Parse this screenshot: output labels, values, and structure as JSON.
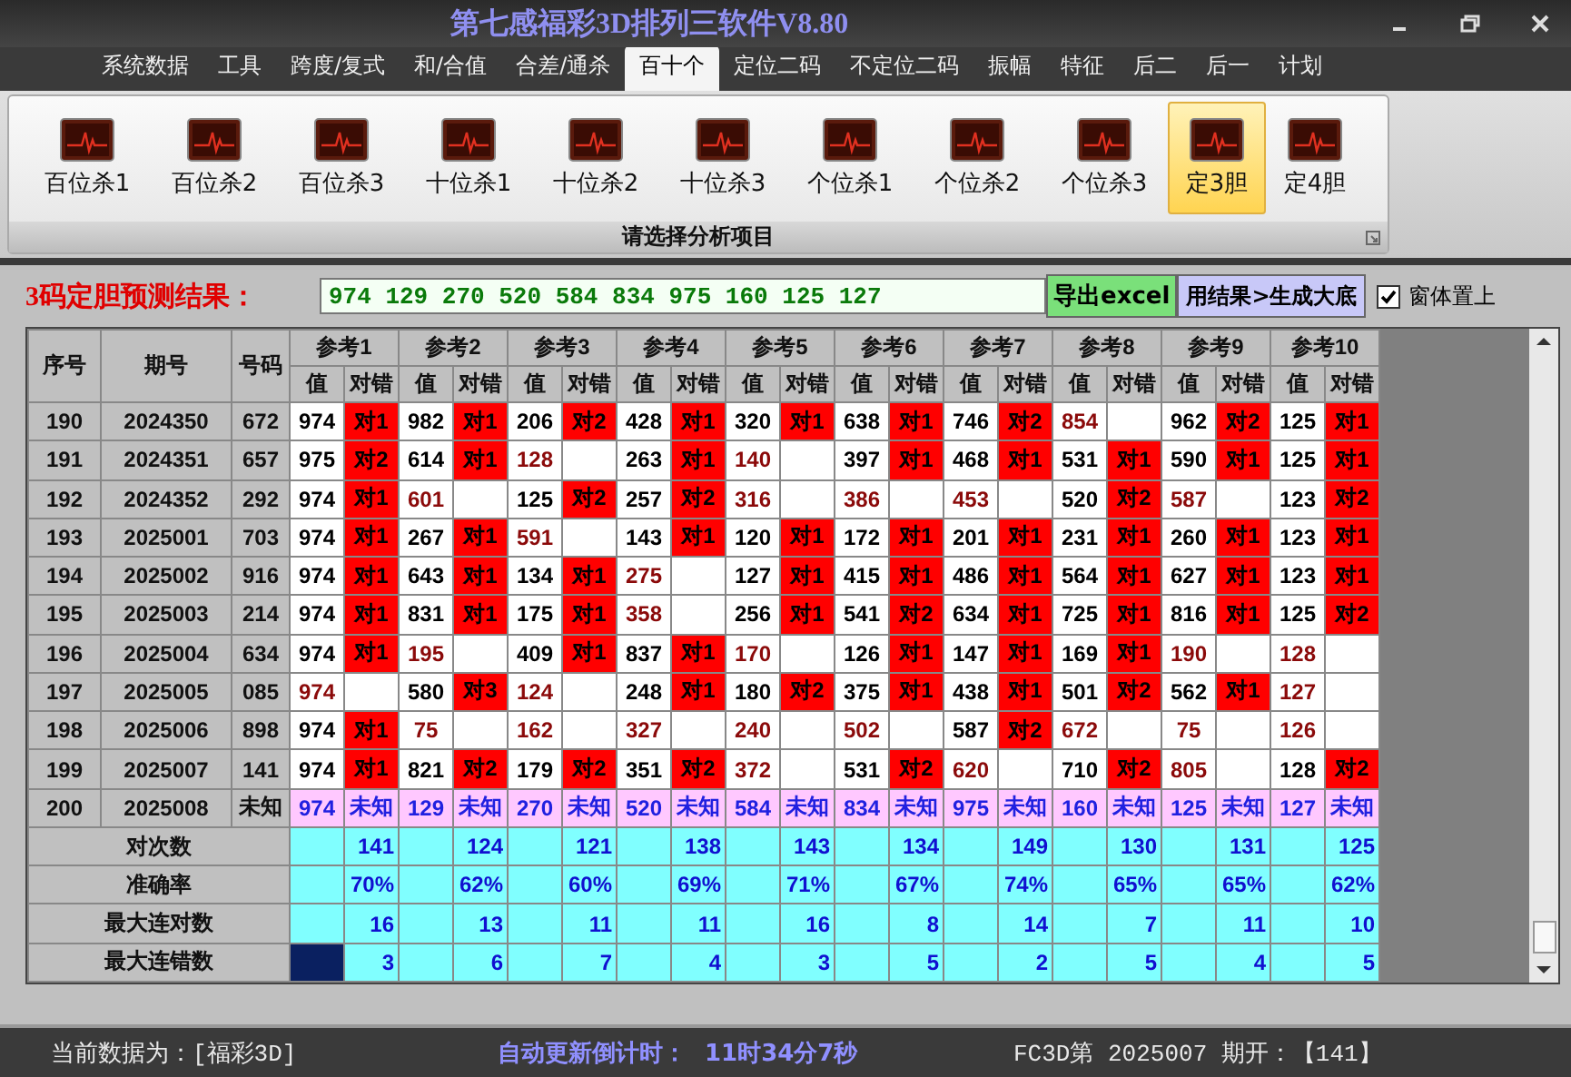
{
  "window": {
    "title": "第七感福彩3D排列三软件V8.80"
  },
  "menu_tabs": [
    {
      "label": "系统数据",
      "selected": false
    },
    {
      "label": "工具",
      "selected": false
    },
    {
      "label": "跨度/复式",
      "selected": false
    },
    {
      "label": "和/合值",
      "selected": false
    },
    {
      "label": "合差/通杀",
      "selected": false
    },
    {
      "label": "百十个",
      "selected": true
    },
    {
      "label": "定位二码",
      "selected": false
    },
    {
      "label": "不定位二码",
      "selected": false
    },
    {
      "label": "振幅",
      "selected": false
    },
    {
      "label": "特征",
      "selected": false
    },
    {
      "label": "后二",
      "selected": false
    },
    {
      "label": "后一",
      "selected": false
    },
    {
      "label": "计划",
      "selected": false
    }
  ],
  "ribbon": {
    "items": [
      {
        "label": "百位杀1",
        "selected": false
      },
      {
        "label": "百位杀2",
        "selected": false
      },
      {
        "label": "百位杀3",
        "selected": false
      },
      {
        "label": "十位杀1",
        "selected": false
      },
      {
        "label": "十位杀2",
        "selected": false
      },
      {
        "label": "十位杀3",
        "selected": false
      },
      {
        "label": "个位杀1",
        "selected": false
      },
      {
        "label": "个位杀2",
        "selected": false
      },
      {
        "label": "个位杀3",
        "selected": false
      },
      {
        "label": "定3胆",
        "selected": true
      },
      {
        "label": "定4胆",
        "selected": false
      }
    ],
    "group_label": "请选择分析项目"
  },
  "result_bar": {
    "label": "3码定胆预测结果：",
    "value": "974 129 270 520 584 834 975 160 125 127",
    "export_button": "导出excel",
    "generate_button": "用结果>生成大底",
    "topmost_checkbox": {
      "label": "窗体置上",
      "checked": true
    }
  },
  "table": {
    "columns": [
      "序号",
      "期号",
      "号码"
    ],
    "ref_headers": [
      {
        "label": "参考1",
        "value_header": "值",
        "result_header": "对错"
      },
      {
        "label": "参考2",
        "value_header": "值",
        "result_header": "对错"
      },
      {
        "label": "参考3",
        "value_header": "值",
        "result_header": "对错"
      },
      {
        "label": "参考4",
        "value_header": "值",
        "result_header": "对错"
      },
      {
        "label": "参考5",
        "value_header": "值",
        "result_header": "对错"
      },
      {
        "label": "参考6",
        "value_header": "值",
        "result_header": "对错"
      },
      {
        "label": "参考7",
        "value_header": "值",
        "result_header": "对错"
      },
      {
        "label": "参考8",
        "value_header": "值",
        "result_header": "对错"
      },
      {
        "label": "参考9",
        "value_header": "值",
        "result_header": "对错"
      },
      {
        "label": "参考10",
        "value_header": "值",
        "result_header": "对错"
      }
    ],
    "rows": [
      {
        "kind": "history",
        "no": "190",
        "issue": "2024350",
        "number": "672",
        "refs": [
          {
            "value": "974",
            "hit": true,
            "result": "对1"
          },
          {
            "value": "982",
            "hit": true,
            "result": "对1"
          },
          {
            "value": "206",
            "hit": true,
            "result": "对2"
          },
          {
            "value": "428",
            "hit": true,
            "result": "对1"
          },
          {
            "value": "320",
            "hit": true,
            "result": "对1"
          },
          {
            "value": "638",
            "hit": true,
            "result": "对1"
          },
          {
            "value": "746",
            "hit": true,
            "result": "对2"
          },
          {
            "value": "854",
            "hit": false
          },
          {
            "value": "962",
            "hit": true,
            "result": "对2"
          },
          {
            "value": "125",
            "hit": true,
            "result": "对1"
          }
        ]
      },
      {
        "kind": "history",
        "no": "191",
        "issue": "2024351",
        "number": "657",
        "refs": [
          {
            "value": "975",
            "hit": true,
            "result": "对2"
          },
          {
            "value": "614",
            "hit": true,
            "result": "对1"
          },
          {
            "value": "128",
            "hit": false
          },
          {
            "value": "263",
            "hit": true,
            "result": "对1"
          },
          {
            "value": "140",
            "hit": false
          },
          {
            "value": "397",
            "hit": true,
            "result": "对1"
          },
          {
            "value": "468",
            "hit": true,
            "result": "对1"
          },
          {
            "value": "531",
            "hit": true,
            "result": "对1"
          },
          {
            "value": "590",
            "hit": true,
            "result": "对1"
          },
          {
            "value": "125",
            "hit": true,
            "result": "对1"
          }
        ]
      },
      {
        "kind": "history",
        "no": "192",
        "issue": "2024352",
        "number": "292",
        "refs": [
          {
            "value": "974",
            "hit": true,
            "result": "对1"
          },
          {
            "value": "601",
            "hit": false
          },
          {
            "value": "125",
            "hit": true,
            "result": "对2"
          },
          {
            "value": "257",
            "hit": true,
            "result": "对2"
          },
          {
            "value": "316",
            "hit": false
          },
          {
            "value": "386",
            "hit": false
          },
          {
            "value": "453",
            "hit": false
          },
          {
            "value": "520",
            "hit": true,
            "result": "对2"
          },
          {
            "value": "587",
            "hit": false
          },
          {
            "value": "123",
            "hit": true,
            "result": "对2"
          }
        ]
      },
      {
        "kind": "history",
        "no": "193",
        "issue": "2025001",
        "number": "703",
        "refs": [
          {
            "value": "974",
            "hit": true,
            "result": "对1"
          },
          {
            "value": "267",
            "hit": true,
            "result": "对1"
          },
          {
            "value": "591",
            "hit": false
          },
          {
            "value": "143",
            "hit": true,
            "result": "对1"
          },
          {
            "value": "120",
            "hit": true,
            "result": "对1"
          },
          {
            "value": "172",
            "hit": true,
            "result": "对1"
          },
          {
            "value": "201",
            "hit": true,
            "result": "对1"
          },
          {
            "value": "231",
            "hit": true,
            "result": "对1"
          },
          {
            "value": "260",
            "hit": true,
            "result": "对1"
          },
          {
            "value": "123",
            "hit": true,
            "result": "对1"
          }
        ]
      },
      {
        "kind": "history",
        "no": "194",
        "issue": "2025002",
        "number": "916",
        "refs": [
          {
            "value": "974",
            "hit": true,
            "result": "对1"
          },
          {
            "value": "643",
            "hit": true,
            "result": "对1"
          },
          {
            "value": "134",
            "hit": true,
            "result": "对1"
          },
          {
            "value": "275",
            "hit": false
          },
          {
            "value": "127",
            "hit": true,
            "result": "对1"
          },
          {
            "value": "415",
            "hit": true,
            "result": "对1"
          },
          {
            "value": "486",
            "hit": true,
            "result": "对1"
          },
          {
            "value": "564",
            "hit": true,
            "result": "对1"
          },
          {
            "value": "627",
            "hit": true,
            "result": "对1"
          },
          {
            "value": "123",
            "hit": true,
            "result": "对1"
          }
        ]
      },
      {
        "kind": "history",
        "no": "195",
        "issue": "2025003",
        "number": "214",
        "refs": [
          {
            "value": "974",
            "hit": true,
            "result": "对1"
          },
          {
            "value": "831",
            "hit": true,
            "result": "对1"
          },
          {
            "value": "175",
            "hit": true,
            "result": "对1"
          },
          {
            "value": "358",
            "hit": false
          },
          {
            "value": "256",
            "hit": true,
            "result": "对1"
          },
          {
            "value": "541",
            "hit": true,
            "result": "对2"
          },
          {
            "value": "634",
            "hit": true,
            "result": "对1"
          },
          {
            "value": "725",
            "hit": true,
            "result": "对1"
          },
          {
            "value": "816",
            "hit": true,
            "result": "对1"
          },
          {
            "value": "125",
            "hit": true,
            "result": "对2"
          }
        ]
      },
      {
        "kind": "history",
        "no": "196",
        "issue": "2025004",
        "number": "634",
        "refs": [
          {
            "value": "974",
            "hit": true,
            "result": "对1"
          },
          {
            "value": "195",
            "hit": false
          },
          {
            "value": "409",
            "hit": true,
            "result": "对1"
          },
          {
            "value": "837",
            "hit": true,
            "result": "对1"
          },
          {
            "value": "170",
            "hit": false
          },
          {
            "value": "126",
            "hit": true,
            "result": "对1"
          },
          {
            "value": "147",
            "hit": true,
            "result": "对1"
          },
          {
            "value": "169",
            "hit": true,
            "result": "对1"
          },
          {
            "value": "190",
            "hit": false
          },
          {
            "value": "128",
            "hit": false
          }
        ]
      },
      {
        "kind": "history",
        "no": "197",
        "issue": "2025005",
        "number": "085",
        "refs": [
          {
            "value": "974",
            "hit": false
          },
          {
            "value": "580",
            "hit": true,
            "result": "对3"
          },
          {
            "value": "124",
            "hit": false
          },
          {
            "value": "248",
            "hit": true,
            "result": "对1"
          },
          {
            "value": "180",
            "hit": true,
            "result": "对2"
          },
          {
            "value": "375",
            "hit": true,
            "result": "对1"
          },
          {
            "value": "438",
            "hit": true,
            "result": "对1"
          },
          {
            "value": "501",
            "hit": true,
            "result": "对2"
          },
          {
            "value": "562",
            "hit": true,
            "result": "对1"
          },
          {
            "value": "127",
            "hit": false
          }
        ]
      },
      {
        "kind": "history",
        "no": "198",
        "issue": "2025006",
        "number": "898",
        "refs": [
          {
            "value": "974",
            "hit": true,
            "result": "对1"
          },
          {
            "value": "75",
            "hit": false
          },
          {
            "value": "162",
            "hit": false
          },
          {
            "value": "327",
            "hit": false
          },
          {
            "value": "240",
            "hit": false
          },
          {
            "value": "502",
            "hit": false
          },
          {
            "value": "587",
            "hit": true,
            "result": "对2"
          },
          {
            "value": "672",
            "hit": false
          },
          {
            "value": "75",
            "hit": false
          },
          {
            "value": "126",
            "hit": false
          }
        ]
      },
      {
        "kind": "history",
        "no": "199",
        "issue": "2025007",
        "number": "141",
        "refs": [
          {
            "value": "974",
            "hit": true,
            "result": "对1"
          },
          {
            "value": "821",
            "hit": true,
            "result": "对2"
          },
          {
            "value": "179",
            "hit": true,
            "result": "对2"
          },
          {
            "value": "351",
            "hit": true,
            "result": "对2"
          },
          {
            "value": "372",
            "hit": false
          },
          {
            "value": "531",
            "hit": true,
            "result": "对2"
          },
          {
            "value": "620",
            "hit": false
          },
          {
            "value": "710",
            "hit": true,
            "result": "对2"
          },
          {
            "value": "805",
            "hit": false
          },
          {
            "value": "128",
            "hit": true,
            "result": "对2"
          }
        ]
      },
      {
        "kind": "pending",
        "no": "200",
        "issue": "2025008",
        "number": "未知",
        "refs": [
          {
            "value": "974",
            "result": "未知"
          },
          {
            "value": "129",
            "result": "未知"
          },
          {
            "value": "270",
            "result": "未知"
          },
          {
            "value": "520",
            "result": "未知"
          },
          {
            "value": "584",
            "result": "未知"
          },
          {
            "value": "834",
            "result": "未知"
          },
          {
            "value": "975",
            "result": "未知"
          },
          {
            "value": "160",
            "result": "未知"
          },
          {
            "value": "125",
            "result": "未知"
          },
          {
            "value": "127",
            "result": "未知"
          }
        ]
      }
    ],
    "summary": [
      {
        "label": "对次数",
        "values": [
          "141",
          "124",
          "121",
          "138",
          "143",
          "134",
          "149",
          "130",
          "131",
          "125"
        ]
      },
      {
        "label": "准确率",
        "values": [
          "70%",
          "62%",
          "60%",
          "69%",
          "71%",
          "67%",
          "74%",
          "65%",
          "65%",
          "62%"
        ]
      },
      {
        "label": "最大连对数",
        "values": [
          "16",
          "13",
          "11",
          "11",
          "16",
          "8",
          "14",
          "7",
          "11",
          "10"
        ]
      },
      {
        "label": "最大连错数",
        "values": [
          "3",
          "6",
          "7",
          "4",
          "3",
          "5",
          "2",
          "5",
          "4",
          "5"
        ]
      }
    ]
  },
  "status_bar": {
    "current_data": "当前数据为：[福彩3D]",
    "countdown_label": "自动更新倒计时：",
    "countdown": "11时34分7秒",
    "latest_draw": "FC3D第 2025007 期开：【141】"
  }
}
